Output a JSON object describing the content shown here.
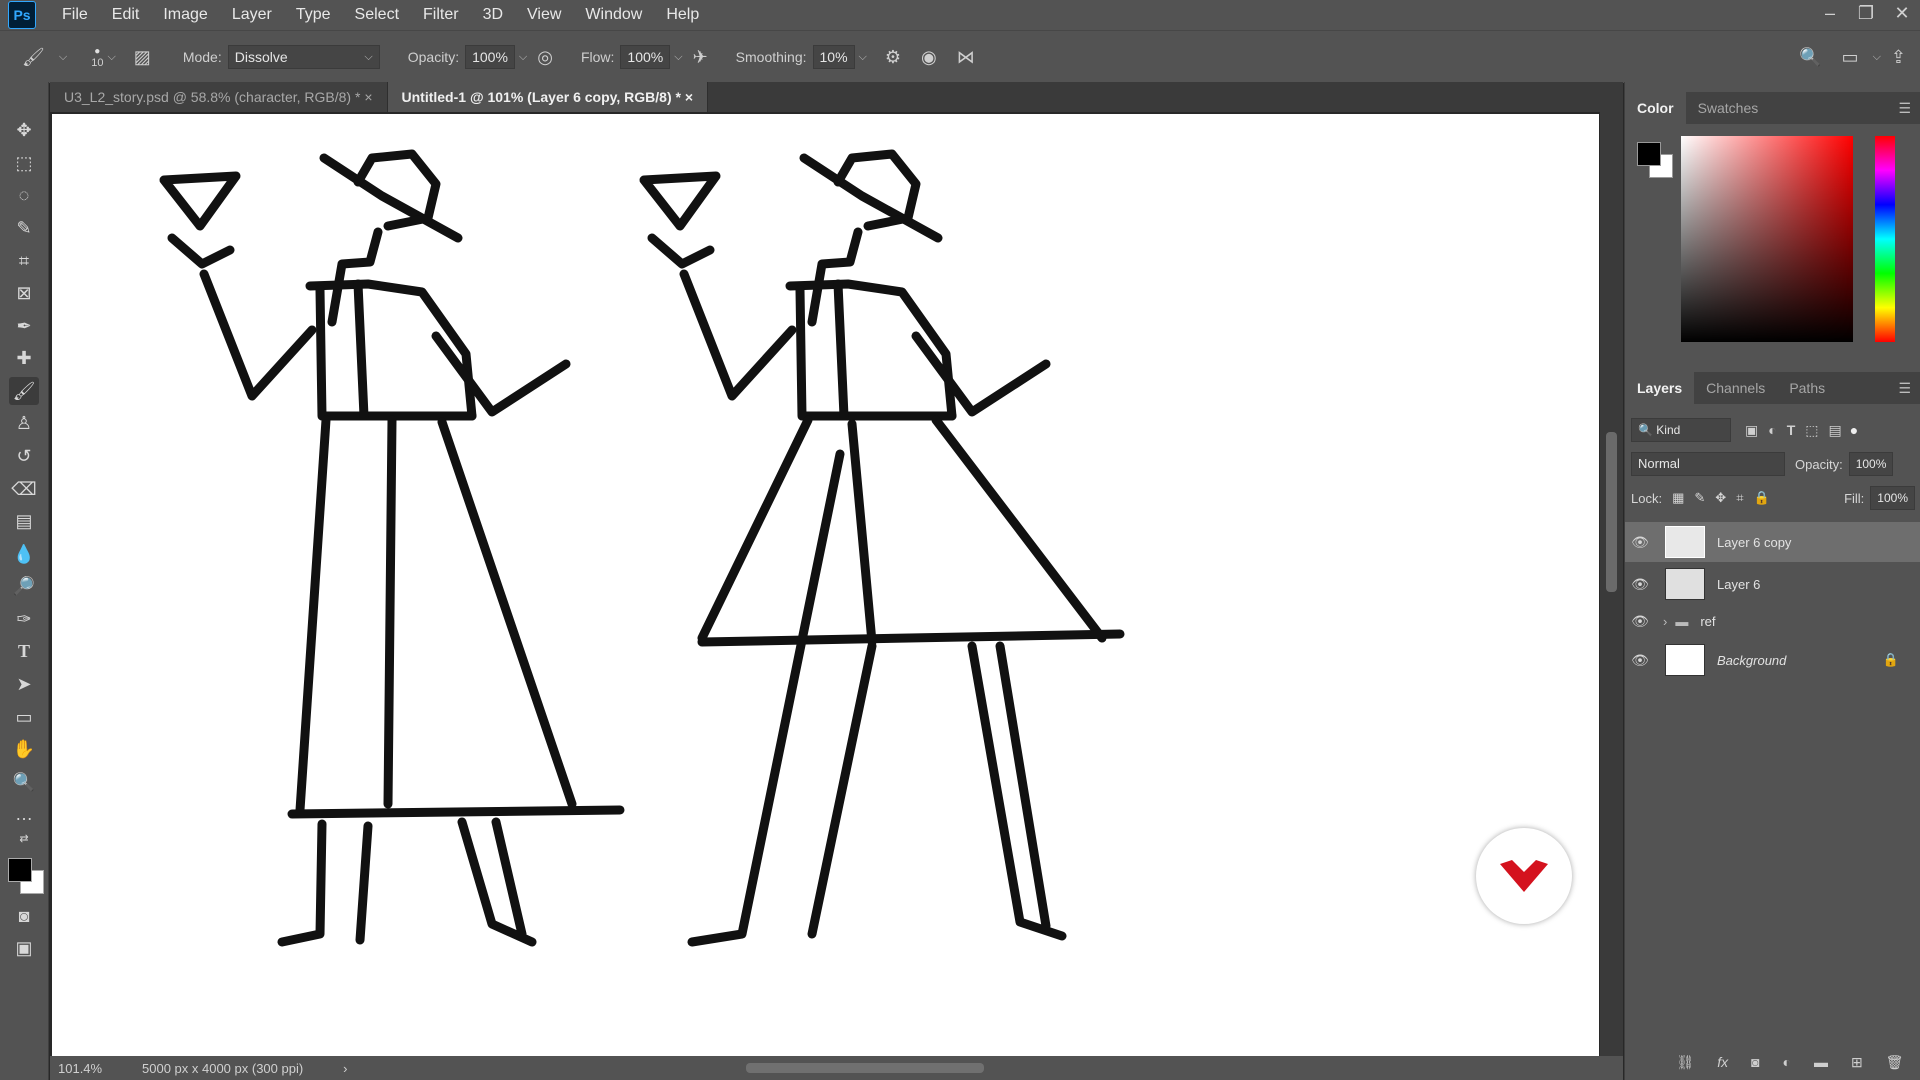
{
  "app": {
    "logo": "Ps"
  },
  "menu": [
    "File",
    "Edit",
    "Image",
    "Layer",
    "Type",
    "Select",
    "Filter",
    "3D",
    "View",
    "Window",
    "Help"
  ],
  "window_controls": [
    "minimize-icon",
    "restore-icon",
    "close-icon"
  ],
  "options_bar": {
    "brush_size": "10",
    "mode_label": "Mode:",
    "mode_value": "Dissolve",
    "opacity_label": "Opacity:",
    "opacity_value": "100%",
    "flow_label": "Flow:",
    "flow_value": "100%",
    "smoothing_label": "Smoothing:",
    "smoothing_value": "10%"
  },
  "tabs": [
    {
      "label": "U3_L2_story.psd @ 58.8% (character, RGB/8) *",
      "close": "×",
      "active": false
    },
    {
      "label": "Untitled-1 @ 101% (Layer 6 copy, RGB/8) *",
      "close": "×",
      "active": true
    }
  ],
  "status": {
    "zoom": "101.4%",
    "doc_size": "5000 px x 4000 px (300 ppi)",
    "arrow": "›"
  },
  "color_panel": {
    "tabs": [
      "Color",
      "Swatches"
    ],
    "fg_color": "#000000",
    "bg_color": "#ffffff"
  },
  "layers_panel": {
    "tabs": [
      "Layers",
      "Channels",
      "Paths"
    ],
    "filter_kind": "Kind",
    "blend_mode": "Normal",
    "opacity_label": "Opacity:",
    "opacity_value": "100%",
    "lock_label": "Lock:",
    "fill_label": "Fill:",
    "fill_value": "100%",
    "layers": [
      {
        "name": "Layer 6 copy",
        "selected": true,
        "type": "pixel"
      },
      {
        "name": "Layer 6",
        "selected": false,
        "type": "pixel"
      },
      {
        "name": "ref",
        "selected": false,
        "type": "group"
      },
      {
        "name": "Background",
        "selected": false,
        "type": "background",
        "locked": true
      }
    ]
  }
}
